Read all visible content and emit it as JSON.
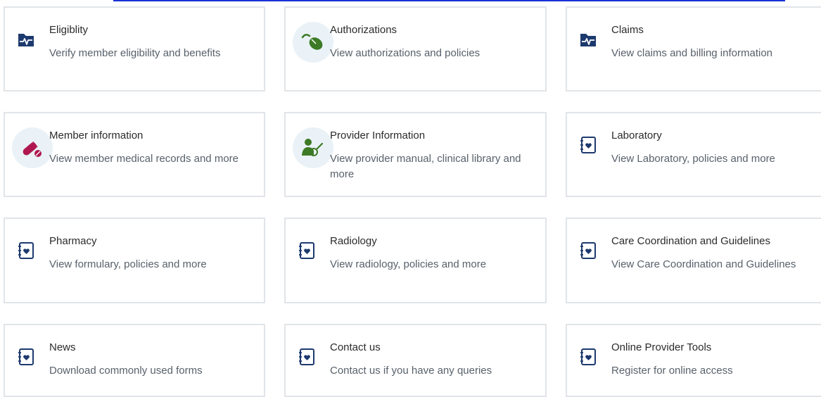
{
  "cards": [
    {
      "title": "Eligiblity",
      "description": "Verify member eligibility and benefits",
      "icon": "pulse-folder-icon"
    },
    {
      "title": "Authorizations",
      "description": "View authorizations and policies",
      "icon": "computer-mouse-icon"
    },
    {
      "title": "Claims",
      "description": "View claims and billing information",
      "icon": "pulse-folder-icon"
    },
    {
      "title": "Member information",
      "description": "View member medical records and more",
      "icon": "pills-icon"
    },
    {
      "title": "Provider Information",
      "description": "View provider manual, clinical library and more",
      "icon": "provider-check-icon"
    },
    {
      "title": "Laboratory",
      "description": "View Laboratory, policies and more",
      "icon": "heart-notebook-icon"
    },
    {
      "title": "Pharmacy",
      "description": "View formulary, policies and more",
      "icon": "heart-notebook-icon"
    },
    {
      "title": "Radiology",
      "description": "View radiology, policies and more",
      "icon": "heart-notebook-icon"
    },
    {
      "title": "Care Coordination and Guidelines",
      "description": "View Care Coordination and Guidelines",
      "icon": "heart-notebook-icon"
    },
    {
      "title": "News",
      "description": "Download commonly used forms",
      "icon": "heart-notebook-icon"
    },
    {
      "title": "Contact us",
      "description": "Contact us if you have any queries",
      "icon": "heart-notebook-icon"
    },
    {
      "title": "Online Provider Tools",
      "description": "Register for online access",
      "icon": "heart-notebook-icon"
    }
  ],
  "colors": {
    "navy": "#1d3a6e",
    "green": "#3d7a26",
    "magenta": "#b0174f",
    "icon_bg": "#eaf2f7",
    "top_link": "#1a32d8"
  }
}
